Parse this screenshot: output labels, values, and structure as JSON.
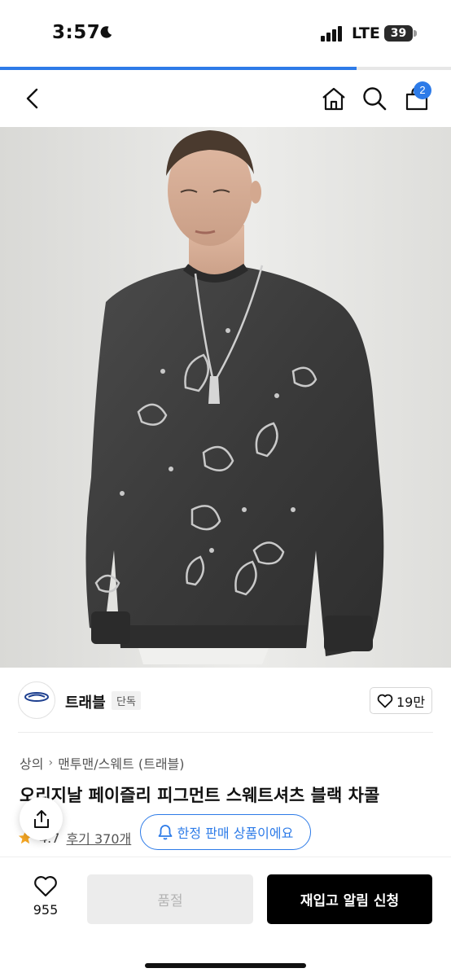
{
  "status_bar": {
    "time": "3:57",
    "network": "LTE",
    "battery": "39"
  },
  "page_load_progress": 0.79,
  "header": {
    "cart_count": "2"
  },
  "product_image": {
    "alt": "trabel paisley pigment sweatshirt black charcoal"
  },
  "brand": {
    "logo_text": "TRAVEL",
    "name": "트래블",
    "exclusive_label": "단독",
    "likes": "19만"
  },
  "breadcrumb": {
    "category": "상의",
    "subcategory": "맨투맨/스웨트 (트래블)"
  },
  "product": {
    "title": "오리지날 페이즐리 피그먼트 스웨트셔츠 블랙 차콜",
    "rating": "4.7",
    "reviews": "후기 370개",
    "limited_notice": "한정 판매 상품이에요"
  },
  "bottom_bar": {
    "wish_count": "955",
    "soldout_label": "품절",
    "restock_label": "재입고 알림 신청"
  },
  "colors": {
    "accent": "#2d7be8",
    "star": "#f5a623",
    "primary_button": "#000000",
    "disabled_button": "#ececec"
  },
  "icons": {
    "back": "chevron-left-icon",
    "home": "home-icon",
    "search": "search-icon",
    "cart": "shopping-bag-icon",
    "heart": "heart-icon",
    "bell": "bell-icon",
    "share": "share-icon",
    "star": "star-icon"
  }
}
